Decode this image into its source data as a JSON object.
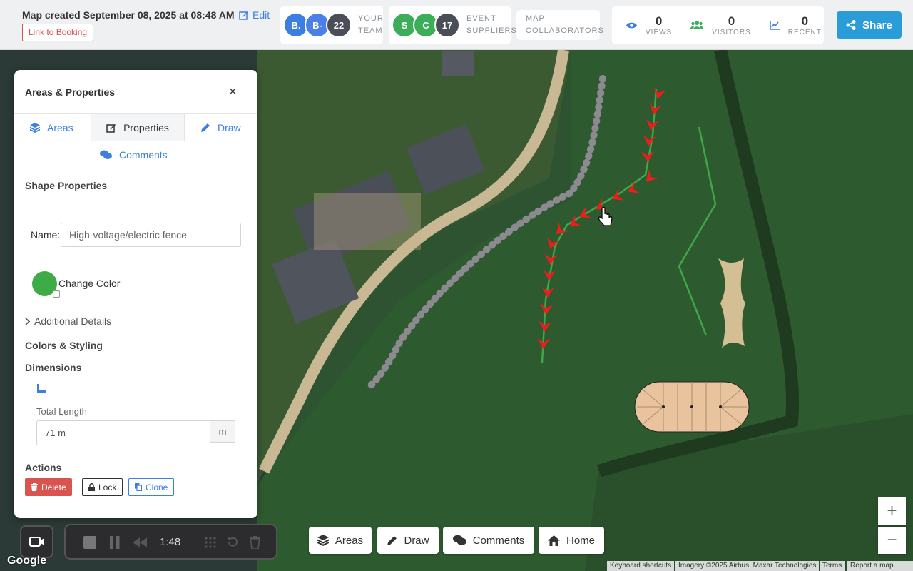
{
  "header": {
    "map_created": "Map created September 08, 2025 at 08:48 AM",
    "edit_label": "Edit",
    "booking_link": "Link to Booking",
    "team": {
      "avatars": [
        {
          "initials": "B.",
          "color": "#3d7fe0"
        },
        {
          "initials": "B-",
          "color": "#4a80e8"
        },
        {
          "initials": "22",
          "color": "#4a4f57"
        }
      ],
      "label_line1": "YOUR",
      "label_line2": "TEAM"
    },
    "suppliers": {
      "avatars": [
        {
          "initials": "S",
          "color": "#3cae5a"
        },
        {
          "initials": "C",
          "color": "#3cae5a"
        },
        {
          "initials": "17",
          "color": "#4a4f57"
        }
      ],
      "label_line1": "EVENT",
      "label_line2": "SUPPLIERS"
    },
    "collaborators": {
      "label_line1": "MAP",
      "label_line2": "COLLABORATORS"
    },
    "stats": [
      {
        "icon": "eye-icon",
        "value": "0",
        "label": "VIEWS"
      },
      {
        "icon": "users-icon",
        "value": "0",
        "label": "VISITORS"
      },
      {
        "icon": "trend-chart-icon",
        "value": "0",
        "label": "RECENT"
      }
    ],
    "share_label": "Share"
  },
  "panel": {
    "title": "Areas & Properties",
    "close": "×",
    "tabs": {
      "areas": "Areas",
      "properties": "Properties",
      "draw": "Draw",
      "comments": "Comments"
    },
    "active_tab": "Properties",
    "shape_properties": "Shape Properties",
    "name_label": "Name:",
    "name_value": "High-voltage/electric fence",
    "color_value": "#3eab46",
    "change_color": "Change Color",
    "additional_details": "Additional Details",
    "colors_styling": "Colors & Styling",
    "dimensions": "Dimensions",
    "total_length_label": "Total Length",
    "total_length_value": "71 m",
    "total_length_unit": "m",
    "actions": "Actions",
    "delete_label": "Delete",
    "lock_label": "Lock",
    "clone_label": "Clone"
  },
  "toolbar": {
    "areas": "Areas",
    "draw": "Draw",
    "comments": "Comments",
    "home": "Home"
  },
  "recorder": {
    "time": "1:48"
  },
  "zoom": {
    "in": "+",
    "out": "−"
  },
  "footer": {
    "google": "Google",
    "keyboard_shortcuts": "Keyboard shortcuts",
    "imagery": "Imagery ©2025 Airbus, Maxar Technologies",
    "terms": "Terms",
    "report": "Report a map error"
  },
  "colors": {
    "accent": "#3d7fe0",
    "share": "#2a9cd8",
    "danger": "#d9534f",
    "fence": "#3eab46",
    "arrow": "#ee1c1c"
  }
}
